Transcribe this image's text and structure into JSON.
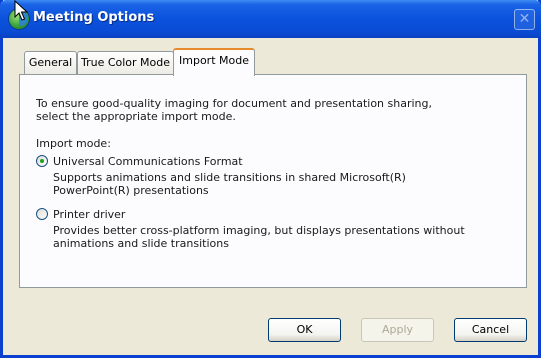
{
  "window": {
    "title": "Meeting Options",
    "close_glyph": "✕"
  },
  "tabs": [
    {
      "label": "General",
      "selected": false
    },
    {
      "label": "True Color Mode",
      "selected": false
    },
    {
      "label": "Import Mode",
      "selected": true
    }
  ],
  "panel": {
    "intro_line1": "To ensure good-quality imaging for document and presentation sharing,",
    "intro_line2": "select the appropriate import mode.",
    "group_label": "Import mode:",
    "options": [
      {
        "label": "Universal Communications Format",
        "description_line1": "Supports animations and slide transitions in shared Microsoft(R)",
        "description_line2": "PowerPoint(R) presentations",
        "checked": true
      },
      {
        "label": "Printer driver",
        "description_line1": "Provides better cross-platform imaging, but displays presentations without",
        "description_line2": "animations and slide transitions",
        "checked": false
      }
    ]
  },
  "buttons": {
    "ok": "OK",
    "apply": "Apply",
    "cancel": "Cancel"
  },
  "colors": {
    "titlebar": "#0a52dc",
    "dialog_bg": "#ece9d8",
    "selected_tab_accent": "#e68b2c",
    "radio_dot": "#21a121"
  },
  "icons": {
    "app": "meeting-app-icon",
    "cursor": "mouse-pointer-icon"
  }
}
